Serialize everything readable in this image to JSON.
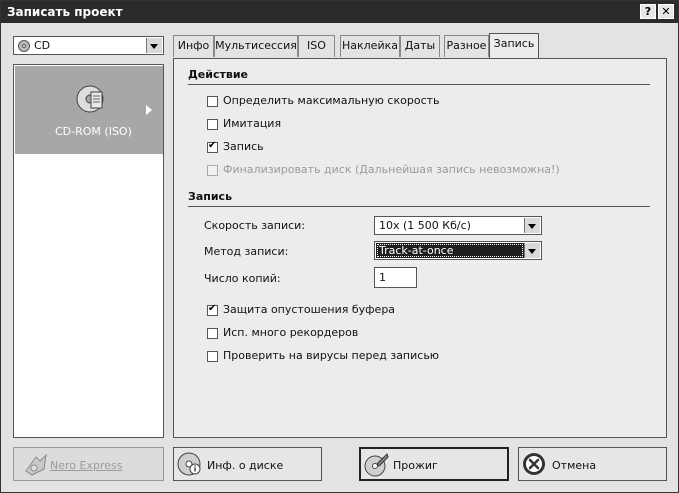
{
  "window": {
    "title": "Записать проект",
    "help_glyph": "?",
    "close_glyph": "✕"
  },
  "media_select": {
    "value": "CD"
  },
  "project": {
    "label": "CD-ROM (ISO)"
  },
  "tabs": [
    {
      "label": "Инфо"
    },
    {
      "label": "Мультисессия"
    },
    {
      "label": "ISO"
    },
    {
      "label": "Наклейка"
    },
    {
      "label": "Даты"
    },
    {
      "label": "Разное"
    },
    {
      "label": "Запись",
      "active": true
    }
  ],
  "action": {
    "heading": "Действие",
    "max_speed": {
      "label": "Определить максимальную скорость",
      "checked": false
    },
    "simulation": {
      "label": "Имитация",
      "checked": false
    },
    "write": {
      "label": "Запись",
      "checked": true
    },
    "finalize": {
      "label": "Финализировать диск (Дальнейшая запись невозможна!)",
      "checked": false,
      "disabled": true
    }
  },
  "write": {
    "heading": "Запись",
    "speed_label": "Скорость записи:",
    "speed_value": "10x (1 500 Кб/с)",
    "method_label": "Метод записи:",
    "method_value": "Track-at-once",
    "copies_label": "Число копий:",
    "copies_value": "1",
    "buffer": {
      "label": "Защита опустошения буфера",
      "checked": true
    },
    "multi_rec": {
      "label": "Исп. много рекордеров",
      "checked": false
    },
    "virus": {
      "label": "Проверить на вирусы перед записью",
      "checked": false
    }
  },
  "buttons": {
    "nero_express": "Nero Express",
    "disc_info": "Инф. о диске",
    "burn": "Прожиг",
    "cancel": "Отмена"
  },
  "colors": {
    "titlebar": "#2b2b2b",
    "window_bg": "#e3e3e3",
    "selected_project": "#a7a7a7",
    "method_highlight": "#1f1f1f"
  }
}
